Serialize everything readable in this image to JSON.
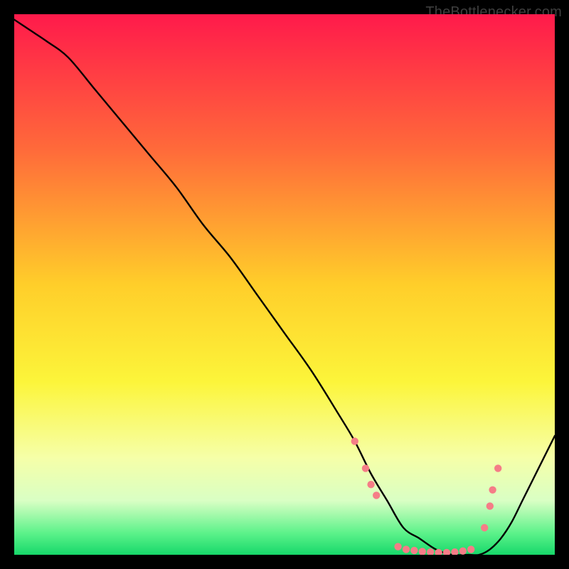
{
  "watermark": "TheBottlenecker.com",
  "chart_data": {
    "type": "line",
    "title": "",
    "xlabel": "",
    "ylabel": "",
    "xlim": [
      0,
      100
    ],
    "ylim": [
      0,
      100
    ],
    "background_gradient": {
      "stops": [
        {
          "offset": 0.0,
          "color": "#ff1a4b"
        },
        {
          "offset": 0.25,
          "color": "#ff6a3a"
        },
        {
          "offset": 0.5,
          "color": "#ffce2a"
        },
        {
          "offset": 0.68,
          "color": "#fcf53a"
        },
        {
          "offset": 0.82,
          "color": "#f6ffa8"
        },
        {
          "offset": 0.9,
          "color": "#d9ffc4"
        },
        {
          "offset": 0.96,
          "color": "#5cf28a"
        },
        {
          "offset": 1.0,
          "color": "#17d86a"
        }
      ]
    },
    "series": [
      {
        "name": "curve",
        "x": [
          0,
          3,
          6,
          10,
          15,
          20,
          25,
          30,
          35,
          40,
          45,
          50,
          55,
          60,
          63,
          66,
          69,
          72,
          75,
          78,
          81,
          84,
          86,
          88,
          90,
          92,
          94,
          96,
          98,
          100
        ],
        "y": [
          99,
          97,
          95,
          92,
          86,
          80,
          74,
          68,
          61,
          55,
          48,
          41,
          34,
          26,
          21,
          15,
          10,
          5,
          3,
          1,
          0,
          0,
          0,
          1,
          3,
          6,
          10,
          14,
          18,
          22
        ]
      }
    ],
    "markers": {
      "color": "#f57d87",
      "radius": 5.2,
      "points": [
        {
          "x": 63,
          "y": 21
        },
        {
          "x": 65,
          "y": 16
        },
        {
          "x": 66,
          "y": 13
        },
        {
          "x": 67,
          "y": 11
        },
        {
          "x": 71,
          "y": 1.5
        },
        {
          "x": 72.5,
          "y": 1
        },
        {
          "x": 74,
          "y": 0.8
        },
        {
          "x": 75.5,
          "y": 0.6
        },
        {
          "x": 77,
          "y": 0.5
        },
        {
          "x": 78.5,
          "y": 0.4
        },
        {
          "x": 80,
          "y": 0.4
        },
        {
          "x": 81.5,
          "y": 0.5
        },
        {
          "x": 83,
          "y": 0.7
        },
        {
          "x": 84.5,
          "y": 1.0
        },
        {
          "x": 87,
          "y": 5
        },
        {
          "x": 88,
          "y": 9
        },
        {
          "x": 88.5,
          "y": 12
        },
        {
          "x": 89.5,
          "y": 16
        }
      ]
    }
  }
}
